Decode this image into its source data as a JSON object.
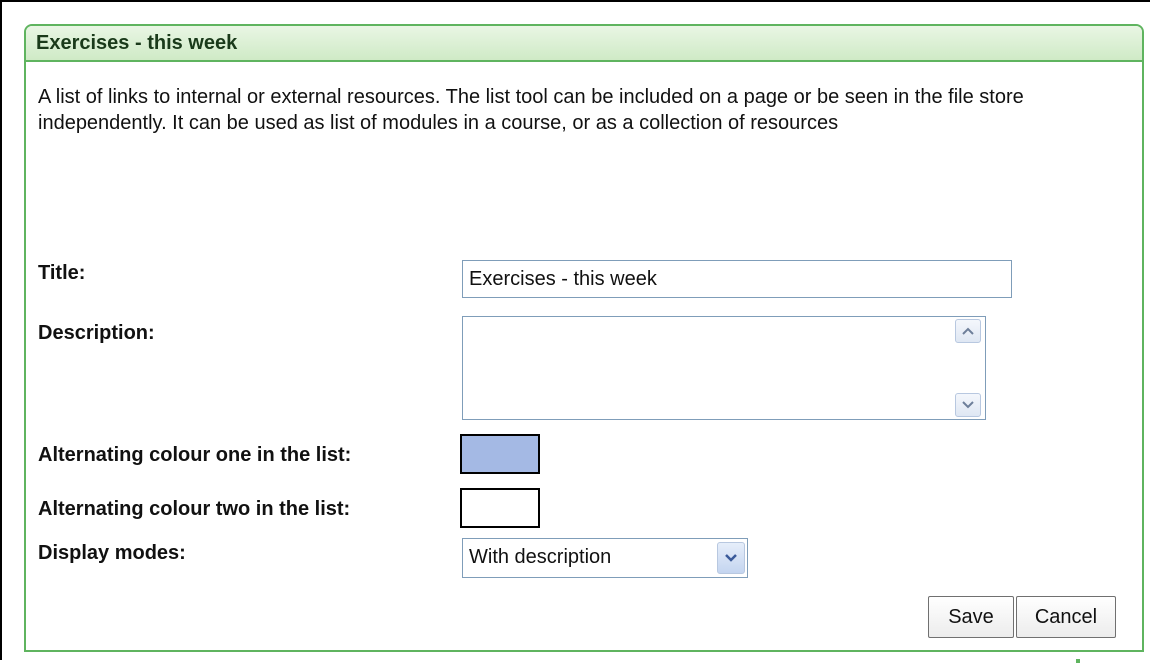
{
  "panel": {
    "title": "Exercises - this week",
    "description": "A list of links to internal or external resources. The list tool can be included on a page or be seen in the file store independently. It can be used as list of modules in a course, or as a collection of resources"
  },
  "form": {
    "title_label": "Title:",
    "title_value": "Exercises - this week",
    "description_label": "Description:",
    "description_value": "",
    "colour_one_label": "Alternating colour one in the list:",
    "colour_one_value": "#a4b9e4",
    "colour_two_label": "Alternating colour two in the list:",
    "colour_two_value": "#ffffff",
    "display_modes_label": "Display modes:",
    "display_modes_value": "With description"
  },
  "buttons": {
    "save_label": "Save",
    "cancel_label": "Cancel"
  },
  "colors": {
    "panel_border": "#5fb45f",
    "header_bg": "#d8efd0"
  },
  "icons": {
    "scroll_up": "scroll-up-arrow-icon",
    "scroll_down": "scroll-down-arrow-icon",
    "select_arrow": "chevron-down-icon"
  }
}
